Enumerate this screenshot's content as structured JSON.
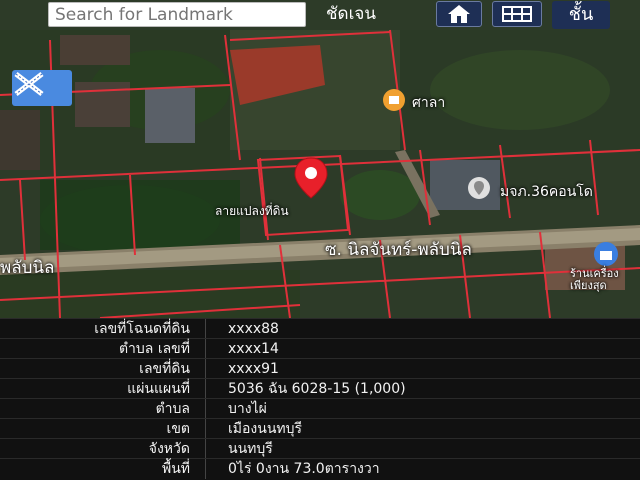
{
  "search": {
    "placeholder": "Search for Landmark"
  },
  "toolbar": {
    "clear_label": "ชัดเจน",
    "layer_label": "ชั้น"
  },
  "map": {
    "labels": {
      "poi_sala": "ศาลา",
      "poi_parcel": "ลายแปลงที่ดิน",
      "poi_condo": "มจภ.36คอนโด",
      "road_1": "ซ. นิลจันทร์-พลับนิล",
      "road_2": "พลับนิล",
      "poi_shop": "ร้านเครื่อง เพียงสุด"
    }
  },
  "details": {
    "rows": [
      {
        "label": "เลขที่โฉนดที่ดิน",
        "value": "xxxx88"
      },
      {
        "label": "ตำบล เลขที่",
        "value": "xxxx14"
      },
      {
        "label": "เลขที่ดิน",
        "value": "xxxx91"
      },
      {
        "label": "แผ่นแผนที่",
        "value": "5036 ฉัน 6028-15 (1,000)"
      },
      {
        "label": "ตำบล",
        "value": "บางไผ่"
      },
      {
        "label": "เขต",
        "value": "เมืองนนทบุรี"
      },
      {
        "label": "จังหวัด",
        "value": "นนทบุรี"
      },
      {
        "label": "พื้นที่",
        "value": "0ไร่ 0งาน 73.0ตารางวา"
      }
    ]
  },
  "colors": {
    "parcel_line": "#e0303a",
    "pin": "#e8202a",
    "button_bg": "#1e2f55",
    "x_button": "#4a8ae0"
  }
}
